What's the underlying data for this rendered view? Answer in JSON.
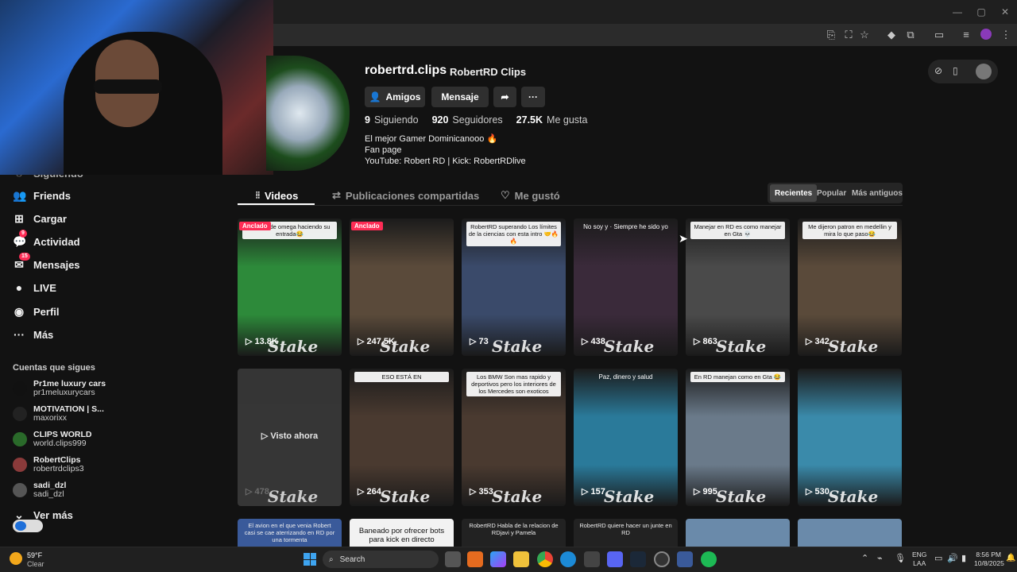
{
  "window": {
    "minimize": "—",
    "maximize": "▢",
    "close": "✕"
  },
  "webcam": {
    "label": ""
  },
  "profile": {
    "username": "robertrd.clips",
    "display_name": "RobertRD Clips",
    "friends_label": "Amigos",
    "message_label": "Mensaje",
    "following_count": "9",
    "following_label": "Siguiendo",
    "followers_count": "920",
    "followers_label": "Seguidores",
    "likes_count": "27.5K",
    "likes_label": "Me gusta",
    "bio": [
      "El mejor Gamer Dominicanooo 🔥",
      "Fan page",
      "YouTube: Robert RD | Kick: RobertRDlive"
    ]
  },
  "tabs": {
    "videos": "Videos",
    "shared": "Publicaciones compartidas",
    "liked": "Me gustó"
  },
  "sort": {
    "recent": "Recientes",
    "popular": "Popular",
    "oldest": "Más antiguos"
  },
  "sidebar": {
    "partial_top": "Siguiendo",
    "items": [
      {
        "label": "Friends",
        "icon": "👥"
      },
      {
        "label": "Cargar",
        "icon": "⊞"
      },
      {
        "label": "Actividad",
        "icon": "💬",
        "badge": "9"
      },
      {
        "label": "Mensajes",
        "icon": "✉",
        "badge": "15"
      },
      {
        "label": "LIVE",
        "icon": "●"
      },
      {
        "label": "Perfil",
        "icon": "◉"
      },
      {
        "label": "Más",
        "icon": "···"
      }
    ],
    "following_header": "Cuentas que sigues",
    "following": [
      {
        "name": "Pr1me luxury cars",
        "handle": "pr1meluxurycars"
      },
      {
        "name": "MOTIVATION | S...",
        "handle": "maxorixx"
      },
      {
        "name": "CLIPS WORLD",
        "handle": "world.clips999"
      },
      {
        "name": "RobertClips",
        "handle": "robertrdclips3"
      },
      {
        "name": "sadi_dzl",
        "handle": "sadi_dzl"
      }
    ],
    "see_more": "Ver más"
  },
  "videos": [
    {
      "views": "13.8K",
      "pinned": "Anclado",
      "caption": "La skin de omega haciendo su entrada😂",
      "bg": "#2d8a3a"
    },
    {
      "views": "247.5K",
      "pinned": "Anclado",
      "caption": "",
      "bg": "#5a4a3a"
    },
    {
      "views": "73",
      "pinned": "",
      "caption": "RobertRD superando Los límites de la ciencias con esta intro 🤝🔥🔥",
      "bg": "#3a4a6a"
    },
    {
      "views": "438",
      "pinned": "",
      "caption": "No soy y · Siempre he sido yo",
      "bg": "#3a2a3a"
    },
    {
      "views": "863",
      "pinned": "",
      "caption": "Manejar en RD es como manejar en Gta 💀",
      "bg": "#4a4a4a"
    },
    {
      "views": "342",
      "pinned": "",
      "caption": "Me dijeron patron en medellin y mira lo que paso😂",
      "bg": "#5a4a3a"
    },
    {
      "views": "478",
      "pinned": "",
      "caption": "",
      "overlay": "Visto ahora",
      "bg": "#333"
    },
    {
      "views": "264",
      "pinned": "",
      "caption": "ESO ESTÁ EN",
      "bg": "#4a3a30"
    },
    {
      "views": "353",
      "pinned": "",
      "caption": "Los BMW Son mas rapido y deportivos pero los interiores de los Mercedes son exoticos",
      "bg": "#4a3a30"
    },
    {
      "views": "157",
      "pinned": "",
      "caption": "Paz, dinero y salud",
      "bg": "#2a7a9a"
    },
    {
      "views": "995",
      "pinned": "",
      "caption": "En RD manejan como en Gta 😂",
      "bg": "#6a7a8a"
    },
    {
      "views": "530",
      "pinned": "",
      "caption": "",
      "bg": "#3a8aaa"
    }
  ],
  "row3": [
    "El avion en el que venia Robert casi se cae aterrizando en RD por una tormenta",
    "Baneado por ofrecer bots para kick en directo",
    "RobertRD Habla de la relacion de RDjavi y Pamela",
    "RobertRD quiere hacer un junte en RD",
    "",
    ""
  ],
  "taskbar": {
    "weather_temp": "59°F",
    "weather_desc": "Clear",
    "search": "Search",
    "lang1": "ENG",
    "lang2": "LAA",
    "time": "8:56 PM",
    "date": "10/8/2025"
  }
}
